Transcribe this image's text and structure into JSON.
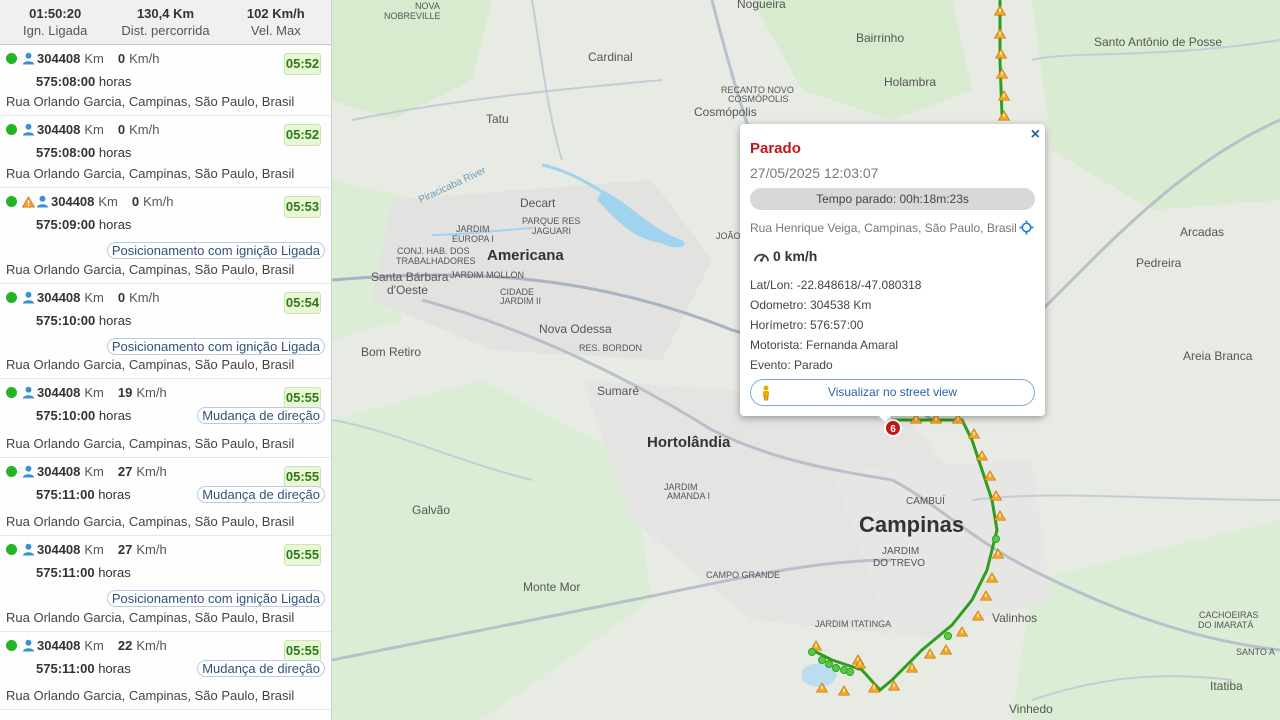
{
  "stats": [
    {
      "value": "01:50:20",
      "label": "Ign. Ligada"
    },
    {
      "value": "130,4 Km",
      "label": "Dist. percorrida"
    },
    {
      "value": "102 Km/h",
      "label": "Vel. Max"
    }
  ],
  "events": [
    {
      "km": "304408",
      "km_unit": "Km",
      "speed": "0",
      "speed_unit": "Km/h",
      "time": "05:52",
      "hours": "575:08:00",
      "hours_unit": "horas",
      "badge": "",
      "address": "Rua Orlando Garcia, Campinas, São Paulo, Brasil",
      "warning": false
    },
    {
      "km": "304408",
      "km_unit": "Km",
      "speed": "0",
      "speed_unit": "Km/h",
      "time": "05:52",
      "hours": "575:08:00",
      "hours_unit": "horas",
      "badge": "",
      "address": "Rua Orlando Garcia, Campinas, São Paulo, Brasil",
      "warning": false
    },
    {
      "km": "304408",
      "km_unit": "Km",
      "speed": "0",
      "speed_unit": "Km/h",
      "time": "05:53",
      "hours": "575:09:00",
      "hours_unit": "horas",
      "badge": "Posicionamento com ignição Ligada",
      "address": "Rua Orlando Garcia, Campinas, São Paulo, Brasil",
      "warning": true
    },
    {
      "km": "304408",
      "km_unit": "Km",
      "speed": "0",
      "speed_unit": "Km/h",
      "time": "05:54",
      "hours": "575:10:00",
      "hours_unit": "horas",
      "badge": "Posicionamento com ignição Ligada",
      "address": "Rua Orlando Garcia, Campinas, São Paulo, Brasil",
      "warning": false
    },
    {
      "km": "304408",
      "km_unit": "Km",
      "speed": "19",
      "speed_unit": "Km/h",
      "time": "05:55",
      "hours": "575:10:00",
      "hours_unit": "horas",
      "badge": "Mudança de direção",
      "address": "Rua Orlando Garcia, Campinas, São Paulo, Brasil",
      "warning": false
    },
    {
      "km": "304408",
      "km_unit": "Km",
      "speed": "27",
      "speed_unit": "Km/h",
      "time": "05:55",
      "hours": "575:11:00",
      "hours_unit": "horas",
      "badge": "Mudança de direção",
      "address": "Rua Orlando Garcia, Campinas, São Paulo, Brasil",
      "warning": false
    },
    {
      "km": "304408",
      "km_unit": "Km",
      "speed": "27",
      "speed_unit": "Km/h",
      "time": "05:55",
      "hours": "575:11:00",
      "hours_unit": "horas",
      "badge": "Posicionamento com ignição Ligada",
      "address": "Rua Orlando Garcia, Campinas, São Paulo, Brasil",
      "warning": false
    },
    {
      "km": "304408",
      "km_unit": "Km",
      "speed": "22",
      "speed_unit": "Km/h",
      "time": "05:55",
      "hours": "575:11:00",
      "hours_unit": "horas",
      "badge": "Mudança de direção",
      "address": "Rua Orlando Garcia, Campinas, São Paulo, Brasil",
      "warning": false
    }
  ],
  "popup": {
    "title": "Parado",
    "datetime": "27/05/2025 12:03:07",
    "stopped_time": "Tempo parado: 00h:18m:23s",
    "address": "Rua Henrique Veiga, Campinas, São Paulo, Brasil",
    "speed": "0 km/h",
    "latlon": "Lat/Lon: -22.848618/-47.080318",
    "odometer": "Odometro: 304538 Km",
    "hourmeter": "Horímetro: 576:57:00",
    "driver": "Motorista: Fernanda Amaral",
    "event": "Evento: Parado",
    "street_view": "Visualizar no street view",
    "close": "×"
  },
  "map": {
    "marker_number": "6",
    "cities": [
      "Americana",
      "Hortolândia",
      "Campinas"
    ],
    "places": [
      "Nogueira",
      "NOVA",
      "NOBREVILLE",
      "Bairrinho",
      "Santo Antônio de Posse",
      "Cardinal",
      "Holambra",
      "RECANTO NOVO",
      "COSMÓPOLIS",
      "Cosmópolis",
      "Tatu",
      "Decart",
      "PARQUE RES",
      "JAGUARI",
      "JARDIM",
      "EUROPA I",
      "CONJ. HAB. DOS",
      "TRABALHADORES",
      "Santa Bárbara",
      "d'Oeste",
      "JARDIM MOLLON",
      "CIDADE",
      "JARDIM II",
      "Nova Odessa",
      "RES. BORDON",
      "Bom Retiro",
      "Sumaré",
      "Arcadas",
      "Pedreira",
      "Areia Branca",
      "CAMBUÍ",
      "JARDIM",
      "DO TREVO",
      "Galvão",
      "CAMPO GRANDE",
      "Monte Mor",
      "JARDIM ITATINGA",
      "Valinhos",
      "Vinhedo",
      "CACHOEIRAS",
      "DO IMARATÁ",
      "SANTO A",
      "Itatiba",
      "JARDIM",
      "AMANDA I",
      "JOÃO",
      "Piracicaba River"
    ],
    "route_color": "#2e9e1f",
    "accent_color": "#2a62a8"
  }
}
